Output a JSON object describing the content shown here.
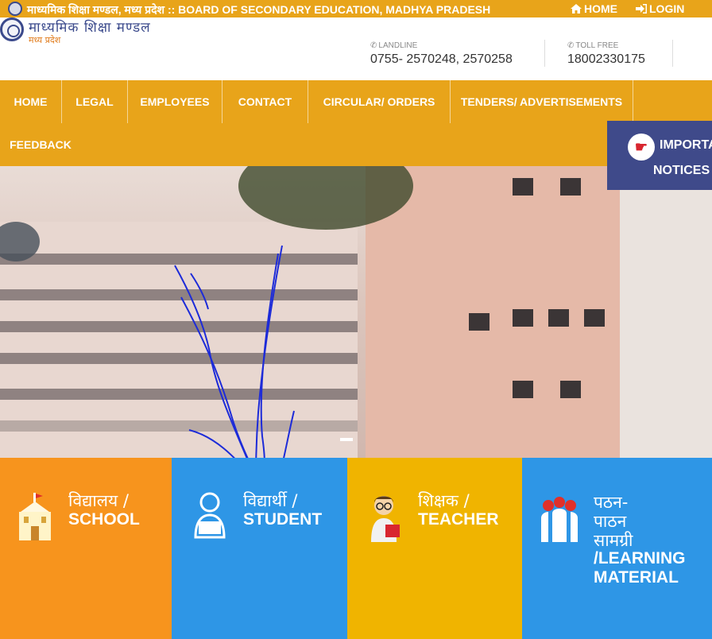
{
  "topbar": {
    "title": "माध्यमिक शिक्षा मण्डल, मध्य प्रदेश :: BOARD OF SECONDARY EDUCATION, MADHYA PRADESH",
    "home": "HOME",
    "login": "LOGIN"
  },
  "brand": {
    "main": "माध्यमिक शिक्षा मण्डल",
    "sub": "मध्य प्रदेश"
  },
  "contacts": {
    "landline_label": "LANDLINE",
    "landline_value": "0755- 2570248, 2570258",
    "tollfree_label": "TOLL FREE",
    "tollfree_value": "18002330175"
  },
  "nav": {
    "items": [
      "HOME",
      "LEGAL",
      "EMPLOYEES",
      "CONTACT",
      "CIRCULAR/ ORDERS",
      "TENDERS/ ADVERTISEMENTS",
      "FEEDBACK"
    ]
  },
  "notices": {
    "line1": "IMPORTA",
    "line2": "NOTICES"
  },
  "tiles": [
    {
      "hi": "विद्यालय /",
      "en": "SCHOOL",
      "color": "#f7941d"
    },
    {
      "hi": "विद्यार्थी /",
      "en": "STUDENT",
      "color": "#2e96e6"
    },
    {
      "hi": "शिक्षक /",
      "en": "TEACHER",
      "color": "#f0b400"
    },
    {
      "hi1": "पठन-",
      "hi2": "पाठन",
      "hi3": "सामग्री",
      "en1": "/LEARNING",
      "en2": "MATERIAL",
      "color": "#2e96e6"
    }
  ],
  "colors": {
    "accent": "#e8a41a",
    "notices": "#3f4a8a",
    "ink": "#1d2bd8"
  },
  "icons": {
    "home": "home-icon",
    "login": "login-icon",
    "phone": "phone-icon",
    "notice": "pointing-hand-icon",
    "school": "school-building-icon",
    "student": "student-reading-icon",
    "teacher": "teacher-icon",
    "material": "people-group-icon"
  }
}
